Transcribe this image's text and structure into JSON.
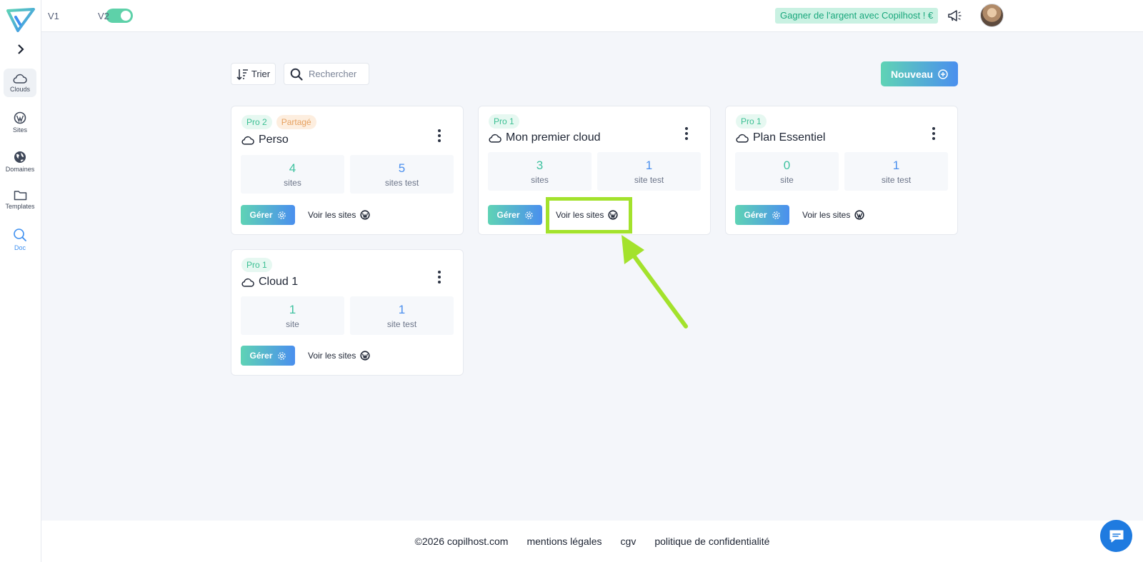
{
  "header": {
    "version_left": "V1",
    "version_right": "V2",
    "promo_text": "Gagner de l'argent avec Copilhost ! €"
  },
  "sidebar": {
    "items": [
      {
        "label": "Clouds",
        "icon": "cloud-icon",
        "active": true
      },
      {
        "label": "Sites",
        "icon": "wordpress-icon",
        "active": false
      },
      {
        "label": "Domaines",
        "icon": "globe-icon",
        "active": false
      },
      {
        "label": "Templates",
        "icon": "folder-icon",
        "active": false
      },
      {
        "label": "Doc",
        "icon": "search-icon",
        "active": false
      }
    ]
  },
  "toolbar": {
    "sort_label": "Trier",
    "search_placeholder": "Rechercher",
    "new_label": "Nouveau"
  },
  "cards": [
    {
      "badges": [
        "Pro 2",
        "Partagé"
      ],
      "title": "Perso",
      "sites_count": "4",
      "sites_label": "sites",
      "test_count": "5",
      "test_label": "sites test",
      "manage_label": "Gérer",
      "view_label": "Voir les sites"
    },
    {
      "badges": [
        "Pro 1"
      ],
      "title": "Mon premier cloud",
      "sites_count": "3",
      "sites_label": "sites",
      "test_count": "1",
      "test_label": "site test",
      "manage_label": "Gérer",
      "view_label": "Voir les sites"
    },
    {
      "badges": [
        "Pro 1"
      ],
      "title": "Plan Essentiel",
      "sites_count": "0",
      "sites_label": "site",
      "test_count": "1",
      "test_label": "site test",
      "manage_label": "Gérer",
      "view_label": "Voir les sites"
    },
    {
      "badges": [
        "Pro 1"
      ],
      "title": "Cloud 1",
      "sites_count": "1",
      "sites_label": "site",
      "test_count": "1",
      "test_label": "site test",
      "manage_label": "Gérer",
      "view_label": "Voir les sites"
    }
  ],
  "footer": {
    "copyright": "©2026 copilhost.com",
    "legal": "mentions légales",
    "cgv": "cgv",
    "privacy": "politique de confidentialité"
  },
  "colors": {
    "accent_teal": "#5fd3b5",
    "accent_blue": "#4a8fee",
    "highlight": "#a3e22c"
  }
}
